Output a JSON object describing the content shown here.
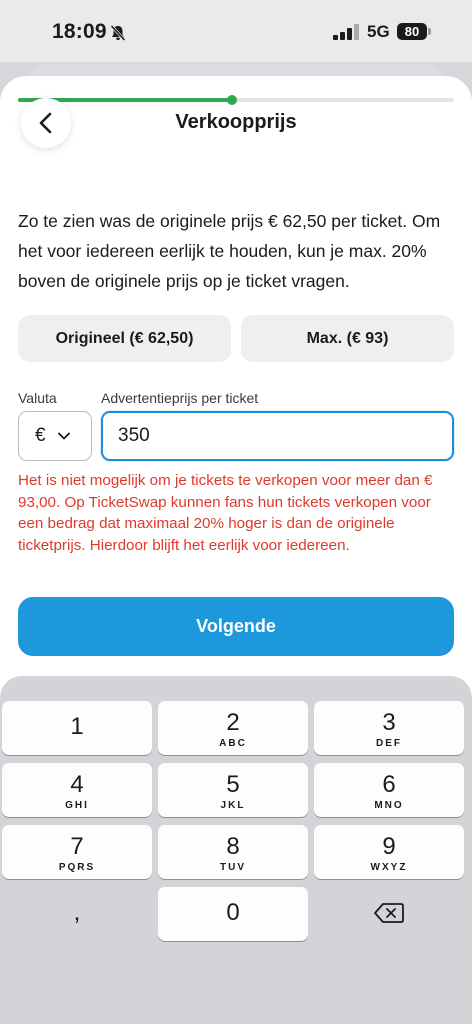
{
  "status": {
    "time": "18:09",
    "network": "5G",
    "battery": "80",
    "icons": [
      "bell-slash-icon",
      "signal-icon",
      "battery-icon"
    ]
  },
  "progress": {
    "fraction": 0.49,
    "color": "#2fa84f"
  },
  "header": {
    "title": "Verkoopprijs",
    "back_icon": "chevron-left-icon"
  },
  "intro": "Zo te zien was de originele prijs € 62,50 per ticket. Om het voor iedereen eerlijk te houden, kun je max. 20% boven de originele prijs op je ticket vragen.",
  "suggestions": [
    {
      "label": "Origineel (€ 62,50)"
    },
    {
      "label": "Max. (€ 93)"
    }
  ],
  "form": {
    "currency_label": "Valuta",
    "currency_value": "€",
    "price_label": "Advertentieprijs per ticket",
    "price_value": "350"
  },
  "error": "Het is niet mogelijk om je tickets te verkopen voor meer dan € 93,00. Op TicketSwap kunnen fans hun tickets verkopen voor een bedrag dat maximaal 20% hoger is dan de originele ticketprijs. Hierdoor blijft het eerlijk voor iedereen.",
  "next_button": "Volgende",
  "keyboard": {
    "keys": [
      {
        "num": "1",
        "sub": ""
      },
      {
        "num": "2",
        "sub": "ABC"
      },
      {
        "num": "3",
        "sub": "DEF"
      },
      {
        "num": "4",
        "sub": "GHI"
      },
      {
        "num": "5",
        "sub": "JKL"
      },
      {
        "num": "6",
        "sub": "MNO"
      },
      {
        "num": "7",
        "sub": "PQRS"
      },
      {
        "num": "8",
        "sub": "TUV"
      },
      {
        "num": "9",
        "sub": "WXYZ"
      },
      {
        "num": "0",
        "sub": ""
      }
    ],
    "comma": ",",
    "delete_icon": "backspace-icon"
  },
  "colors": {
    "accent": "#1d98dd",
    "error": "#e0392b",
    "progress": "#2fa84f"
  }
}
